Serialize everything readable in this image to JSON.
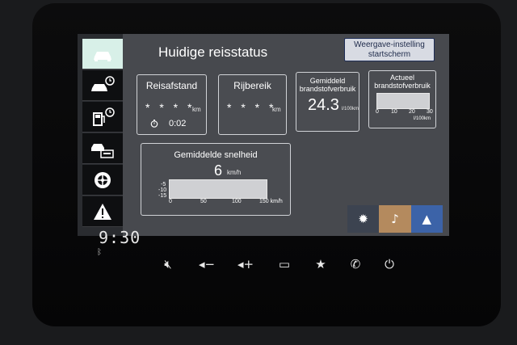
{
  "header": {
    "title": "Huidige reisstatus",
    "display_button_line1": "Weergave-instelling",
    "display_button_line2": "startscherm"
  },
  "left_menu": [
    {
      "icon": "car-icon",
      "active": true
    },
    {
      "icon": "car-clock-icon",
      "active": false
    },
    {
      "icon": "fuel-clock-icon",
      "active": false
    },
    {
      "icon": "vehicle-settings-icon",
      "active": false
    },
    {
      "icon": "tire-icon",
      "active": false
    },
    {
      "icon": "warning-icon",
      "active": false
    }
  ],
  "tiles": {
    "reisafstand": {
      "label": "Reisafstand",
      "value": "* * * *",
      "unit": "km",
      "time": "0:02"
    },
    "rijbereik": {
      "label": "Rijbereik",
      "value": "* * * *",
      "unit": "km"
    },
    "gemiddeld": {
      "label_line1": "Gemiddeld",
      "label_line2": "brandstofverbruik",
      "value": "24.3",
      "unit": "l/100km"
    },
    "actueel": {
      "label_line1": "Actueel",
      "label_line2": "brandstofverbruik",
      "ticks": [
        "0",
        "10",
        "20",
        "30"
      ],
      "unit": "l/100km"
    },
    "snelheid": {
      "label": "Gemiddelde snelheid",
      "value": "6",
      "unit": "km/h",
      "ticks": [
        "0",
        "50",
        "100",
        "150 km/h"
      ],
      "side_ticks": [
        "-5",
        "-10",
        "-15"
      ]
    }
  },
  "mode_buttons": [
    {
      "icon": "settings-icon",
      "color": "#3c4350"
    },
    {
      "icon": "music-icon",
      "color": "#b48a5e"
    },
    {
      "icon": "navigation-icon",
      "color": "#3c63a8"
    }
  ],
  "status": {
    "clock": "9:30"
  },
  "hardware_buttons": [
    "mute-icon",
    "volume-down-icon",
    "volume-up-icon",
    "screen-off-icon",
    "favorite-star-icon",
    "phone-icon",
    "power-icon"
  ]
}
